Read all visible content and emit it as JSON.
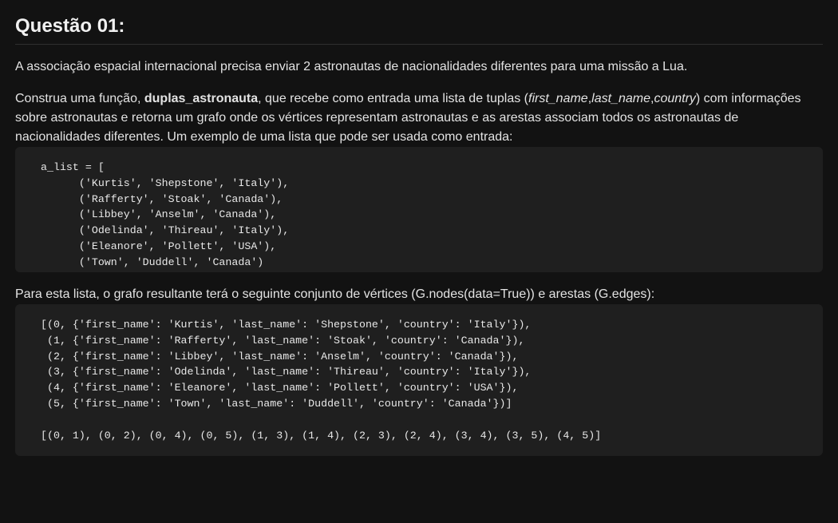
{
  "title": "Questão 01:",
  "paragraph1": "A associação espacial internacional precisa enviar 2 astronautas de nacionalidades diferentes para uma missão a Lua.",
  "paragraph2": {
    "before": "Construa uma função, ",
    "function_name": "duplas_astronauta",
    "middle": ", que recebe como entrada uma lista de tuplas (",
    "field1": "first_name",
    "sep1": ",",
    "field2": "last_name",
    "sep2": ",",
    "field3": "country",
    "after": ") com informações sobre astronautas e retorna um grafo onde os vértices representam astronautas e as arestas associam todos os astronautas de nacionalidades diferentes. Um exemplo de uma lista que pode ser usada como entrada:"
  },
  "code1": {
    "lines": [
      "a_list = [",
      "      ('Kurtis', 'Shepstone', 'Italy'),",
      "      ('Rafferty', 'Stoak', 'Canada'),",
      "      ('Libbey', 'Anselm', 'Canada'),",
      "      ('Odelinda', 'Thireau', 'Italy'),",
      "      ('Eleanore', 'Pollett', 'USA'),",
      "      ('Town', 'Duddell', 'Canada')",
      "]"
    ]
  },
  "paragraph3": "Para esta lista, o grafo resultante terá o seguinte conjunto de vértices (G.nodes(data=True)) e arestas (G.edges):",
  "code2": {
    "lines": [
      "[(0, {'first_name': 'Kurtis', 'last_name': 'Shepstone', 'country': 'Italy'}),",
      " (1, {'first_name': 'Rafferty', 'last_name': 'Stoak', 'country': 'Canada'}),",
      " (2, {'first_name': 'Libbey', 'last_name': 'Anselm', 'country': 'Canada'}),",
      " (3, {'first_name': 'Odelinda', 'last_name': 'Thireau', 'country': 'Italy'}),",
      " (4, {'first_name': 'Eleanore', 'last_name': 'Pollett', 'country': 'USA'}),",
      " (5, {'first_name': 'Town', 'last_name': 'Duddell', 'country': 'Canada'})]",
      "",
      "[(0, 1), (0, 2), (0, 4), (0, 5), (1, 3), (1, 4), (2, 3), (2, 4), (3, 4), (3, 5), (4, 5)]"
    ]
  }
}
